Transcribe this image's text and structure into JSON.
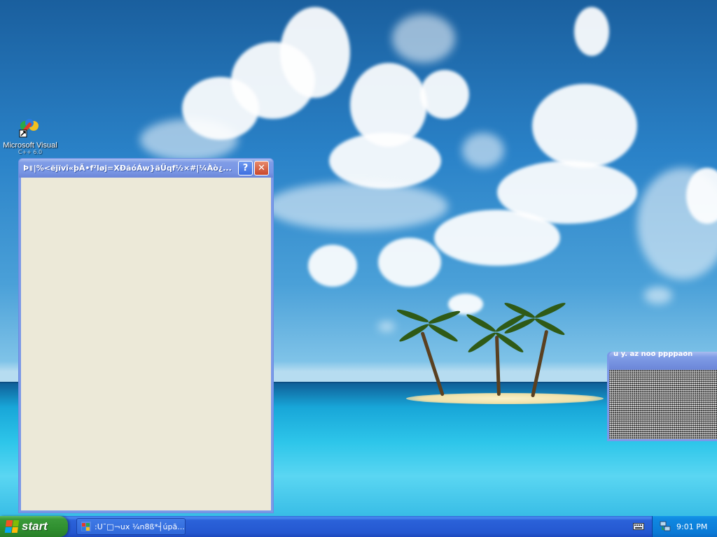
{
  "desktop": {
    "icon": {
      "label": "Microsoft Visual",
      "label_second_line": "C++ 6.0",
      "icon_name": "visual-studio-icon"
    }
  },
  "dialog": {
    "title": "Þ꠱|%<ëjïvî«þÃ•f²løj=XÐãóÁw}äÜqf½×#|¼Àò¿...",
    "help_label": "?",
    "close_label": "✕"
  },
  "side_window": {
    "title": "ù ý. áž ñòð þþpþäðñ"
  },
  "taskbar": {
    "start_label": "start",
    "task_label": ":U¯□¬ux ¼n8ß*┤úpã...",
    "clock": "9:01 PM"
  },
  "colors": {
    "titlebar": "#7b98e8",
    "dialog_body": "#ece9d8",
    "taskbar": "#2457d0",
    "start_button": "#2f8f2f",
    "tray": "#0b7ad6"
  }
}
